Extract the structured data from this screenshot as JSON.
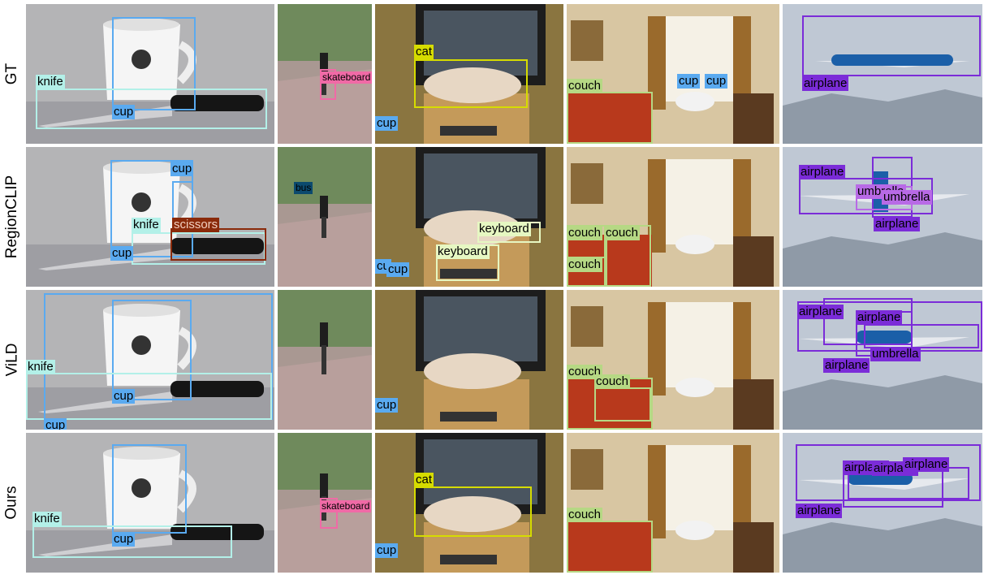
{
  "rows": [
    "GT",
    "RegionCLIP",
    "ViLD",
    "Ours"
  ],
  "colors": {
    "knife": "#b3f0e8",
    "cup": "#5aaaf0",
    "skateboard": "#f06aa6",
    "cat": "#d6dc00",
    "couch": "#b6d884",
    "airplane": "#7b2cd8",
    "umbrella": "#b86ae6",
    "keyboard": "#e6f7c2",
    "scissors": "#8a2a0a",
    "bus": "#0c4a6e"
  },
  "labels": {
    "knife": "knife",
    "cup": "cup",
    "cup_cut": "cu",
    "skateboard": "skateboard",
    "cat": "cat",
    "couch": "couch",
    "airplane": "airplane",
    "airplane_cut": "airplane",
    "umbrella": "umbrella",
    "umbrella_cut": "umbrella",
    "keyboard": "keyboard",
    "scissors": "scissors",
    "bus": "bus"
  }
}
